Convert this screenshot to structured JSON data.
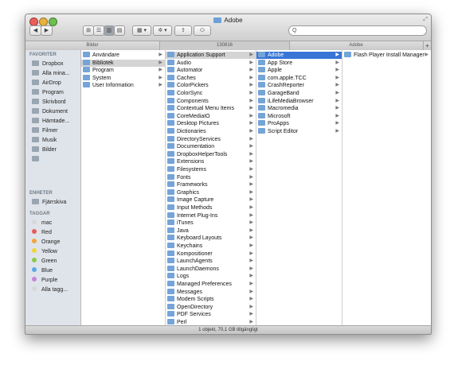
{
  "window": {
    "title": "Adobe"
  },
  "toolbar": {
    "back": "◀",
    "forward": "▶",
    "view_icons": "⊞",
    "view_list": "☰",
    "view_columns": "▥",
    "view_coverflow": "▤",
    "arrange": "▦ ▾",
    "action": "✲ ▾",
    "share": "⇪",
    "tag": "⬭",
    "search_placeholder": "Q"
  },
  "pathbar": {
    "segments": [
      "Bilder",
      "130816",
      "Adobe"
    ],
    "plus": "+"
  },
  "sidebar": {
    "favorites_header": "FAVORITER",
    "favorites": [
      "Dropbox",
      "Alla mina...",
      "AirDrop",
      "Program",
      "Skrivbord",
      "Dokument",
      "Hämtade...",
      "Filmer",
      "Musik",
      "Bilder",
      ""
    ],
    "devices_header": "ENHETER",
    "devices": [
      "Fjärrskiva"
    ],
    "tags_header": "TAGGAR",
    "tags": [
      {
        "label": "mac",
        "color": "#d8d8d8"
      },
      {
        "label": "Red",
        "color": "#e65b5b"
      },
      {
        "label": "Orange",
        "color": "#f4a43b"
      },
      {
        "label": "Yellow",
        "color": "#f0d33d"
      },
      {
        "label": "Green",
        "color": "#8cc84b"
      },
      {
        "label": "Blue",
        "color": "#5aa8e8"
      },
      {
        "label": "Purple",
        "color": "#c784d8"
      },
      {
        "label": "Alla tagg...",
        "color": "#d8d8d8"
      }
    ]
  },
  "columns": {
    "c1": [
      "Användare",
      "Bibliotek",
      "Program",
      "System",
      "User Information"
    ],
    "c2": [
      "Application Support",
      "Audio",
      "Automator",
      "Caches",
      "ColorPickers",
      "ColorSync",
      "Components",
      "Contextual Menu Items",
      "CoreMediaIO",
      "Desktop Pictures",
      "Dictionaries",
      "DirectoryServices",
      "Documentation",
      "DropboxHelperTools",
      "Extensions",
      "Filesystems",
      "Fonts",
      "Frameworks",
      "Graphics",
      "Image Capture",
      "Input Methods",
      "Internet Plug-Ins",
      "iTunes",
      "Java",
      "Keyboard Layouts",
      "Keychains",
      "Kompositioner",
      "LaunchAgents",
      "LaunchDaemons",
      "Logs",
      "Managed Preferences",
      "Messages",
      "Modem Scripts",
      "OpenDirectory",
      "PDF Services",
      "Perl"
    ],
    "c3": [
      "Adobe",
      "App Store",
      "Apple",
      "com.apple.TCC",
      "CrashReporter",
      "GarageBand",
      "iLifeMediaBrowser",
      "Macromedia",
      "Microsoft",
      "ProApps",
      "Script Editor"
    ],
    "c4": [
      "Flash Player Install Manager"
    ]
  },
  "status": {
    "text": "1 objekt, 70,1 GB tillgängligt"
  },
  "colors": {
    "selection": "#3875d7",
    "selection_inactive": "#d4d4d4",
    "folder": "#74a4d8",
    "sidebar": "#dfe4ea"
  }
}
